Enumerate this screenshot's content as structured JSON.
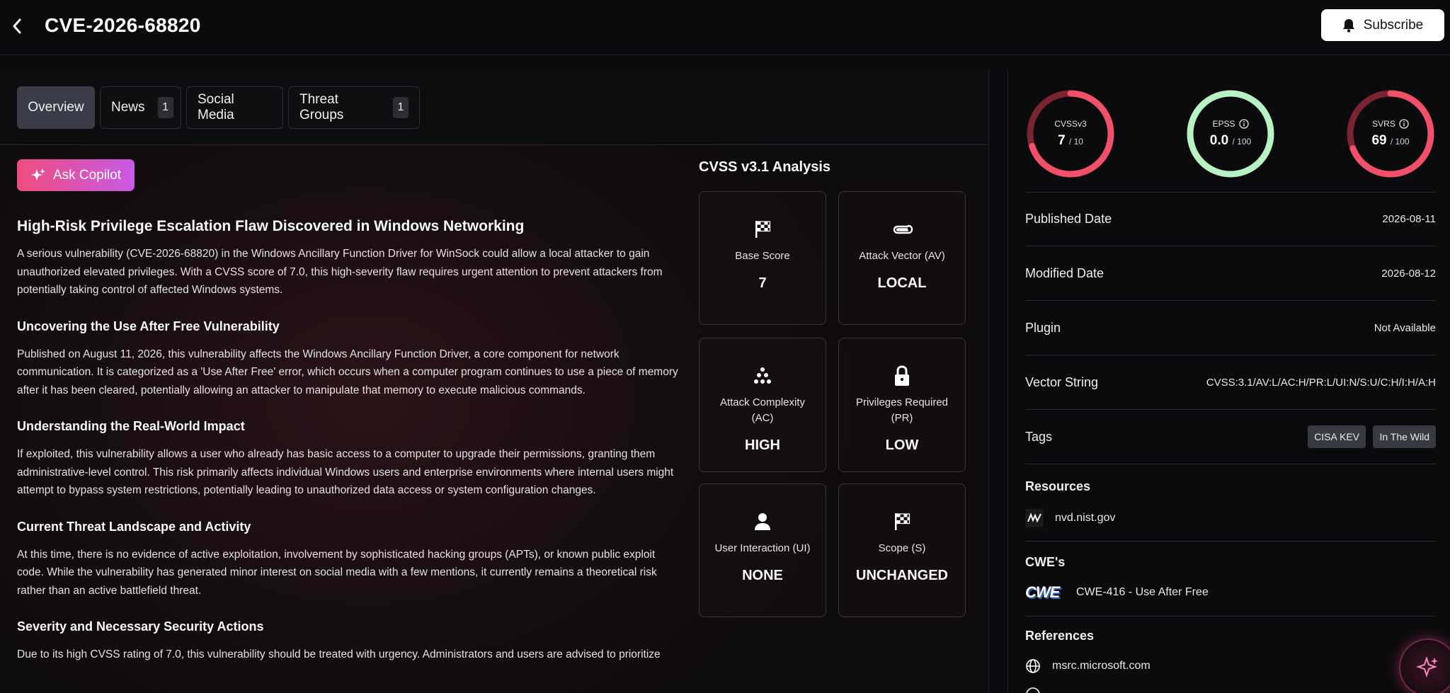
{
  "header": {
    "title": "CVE-2026-68820",
    "subscribe_label": "Subscribe"
  },
  "tabs": [
    {
      "label": "Overview",
      "count": null,
      "active": true
    },
    {
      "label": "News",
      "count": "1"
    },
    {
      "label": "Social Media",
      "count": null
    },
    {
      "label": "Threat Groups",
      "count": "1"
    }
  ],
  "copilot": {
    "label": "Ask Copilot"
  },
  "article": {
    "title": "High-Risk Privilege Escalation Flaw Discovered in Windows Networking",
    "intro": "A serious vulnerability (CVE-2026-68820) in the Windows Ancillary Function Driver for WinSock could allow a local attacker to gain unauthorized elevated privileges. With a CVSS score of 7.0, this high-severity flaw requires urgent attention to prevent attackers from potentially taking control of affected Windows systems.",
    "sections": [
      {
        "heading": "Uncovering the Use After Free Vulnerability",
        "body": "Published on August 11, 2026, this vulnerability affects the Windows Ancillary Function Driver, a core component for network communication. It is categorized as a 'Use After Free' error, which occurs when a computer program continues to use a piece of memory after it has been cleared, potentially allowing an attacker to manipulate that memory to execute malicious commands."
      },
      {
        "heading": "Understanding the Real-World Impact",
        "body": "If exploited, this vulnerability allows a user who already has basic access to a computer to upgrade their permissions, granting them administrative-level control. This risk primarily affects individual Windows users and enterprise environments where internal users might attempt to bypass system restrictions, potentially leading to unauthorized data access or system configuration changes."
      },
      {
        "heading": "Current Threat Landscape and Activity",
        "body": "At this time, there is no evidence of active exploitation, involvement by sophisticated hacking groups (APTs), or known public exploit code. While the vulnerability has generated minor interest on social media with a few mentions, it currently remains a theoretical risk rather than an active battlefield threat."
      },
      {
        "heading": "Severity and Necessary Security Actions",
        "body": "Due to its high CVSS rating of 7.0, this vulnerability should be treated with urgency. Administrators and users are advised to prioritize"
      }
    ]
  },
  "cvss": {
    "heading": "CVSS v3.1 Analysis",
    "metrics": [
      {
        "label": "Base Score",
        "value": "7",
        "icon": "checkered-flag-icon"
      },
      {
        "label": "Attack Vector (AV)",
        "value": "LOCAL",
        "icon": "paperclip-icon"
      },
      {
        "label": "Attack Complexity (AC)",
        "value": "HIGH",
        "icon": "dots-cluster-icon"
      },
      {
        "label": "Privileges Required (PR)",
        "value": "LOW",
        "icon": "lock-icon"
      },
      {
        "label": "User Interaction (UI)",
        "value": "NONE",
        "icon": "user-icon"
      },
      {
        "label": "Scope (S)",
        "value": "UNCHANGED",
        "icon": "checkered-flag-icon"
      }
    ]
  },
  "scores": [
    {
      "name": "CVSSv3",
      "value": "7",
      "max": "/ 10",
      "fraction": 0.7,
      "color": "#f0506a",
      "track": "#7a2432",
      "info": false
    },
    {
      "name": "EPSS",
      "value": "0.0",
      "max": "/ 100",
      "fraction": 0.0,
      "color": "#b8f2c4",
      "track": "#b8f2c4",
      "info": true
    },
    {
      "name": "SVRS",
      "value": "69",
      "max": "/ 100",
      "fraction": 0.69,
      "color": "#f0506a",
      "track": "#7a2432",
      "info": true
    }
  ],
  "details": {
    "published_label": "Published Date",
    "published_value": "2026-08-11",
    "modified_label": "Modified Date",
    "modified_value": "2026-08-12",
    "plugin_label": "Plugin",
    "plugin_value": "Not Available",
    "vector_label": "Vector String",
    "vector_value": "CVSS:3.1/AV:L/AC:H/PR:L/UI:N/S:U/C:H/I:H/A:H",
    "tags_label": "Tags",
    "tags": [
      "CISA KEV",
      "In The Wild"
    ]
  },
  "resources": {
    "title": "Resources",
    "items": [
      "nvd.nist.gov"
    ]
  },
  "cwe": {
    "title": "CWE's",
    "logo_text": "CWE",
    "items": [
      "CWE-416 - Use After Free"
    ]
  },
  "references": {
    "title": "References",
    "items": [
      "msrc.microsoft.com"
    ]
  }
}
